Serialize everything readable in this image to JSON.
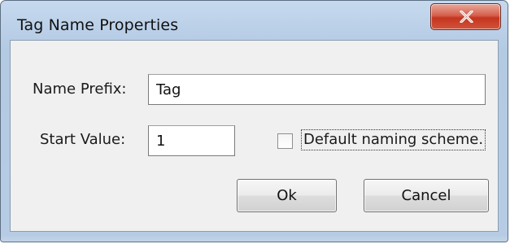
{
  "dialog": {
    "title": "Tag Name Properties"
  },
  "titlebar": {
    "close_icon": "close-icon",
    "close_color": "#c4351f"
  },
  "form": {
    "name_prefix_label": "Name Prefix:",
    "name_prefix_value": "Tag",
    "start_value_label": "Start Value:",
    "start_value_value": "1",
    "default_naming_label": "Default naming scheme.",
    "default_naming_checked": false
  },
  "buttons": {
    "ok_label": "Ok",
    "cancel_label": "Cancel"
  }
}
